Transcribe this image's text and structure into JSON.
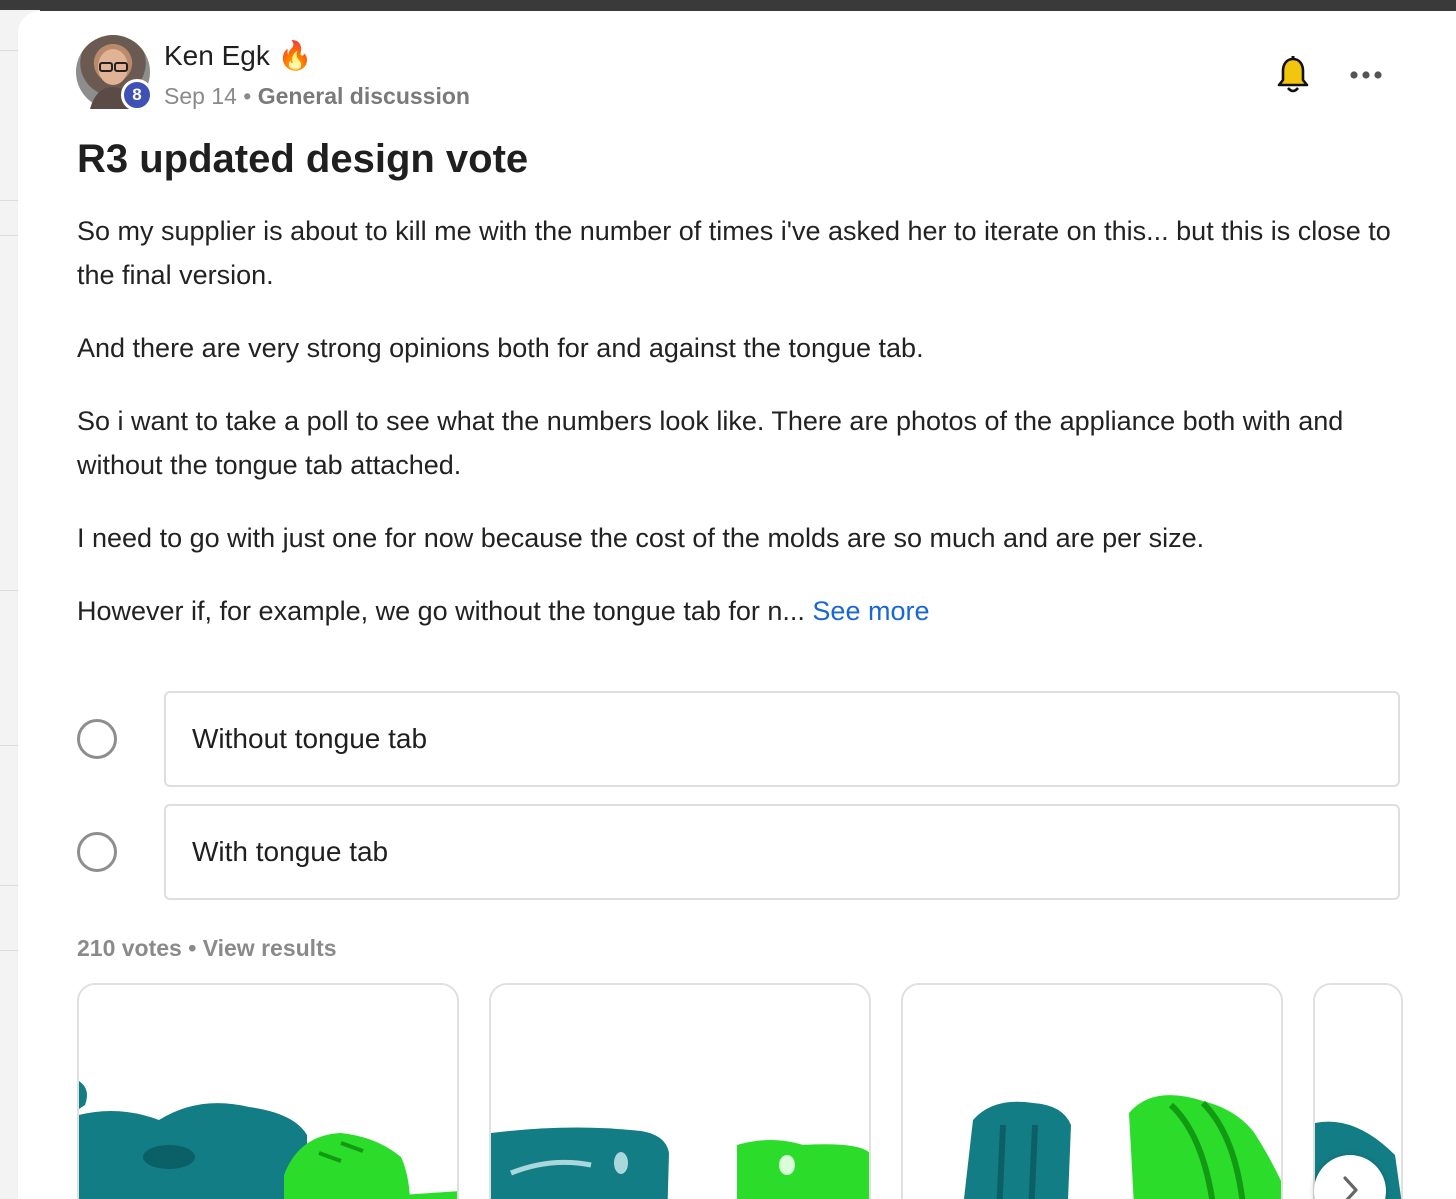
{
  "post": {
    "author": "Ken Egk",
    "author_emoji": "🔥",
    "level": "8",
    "date": "Sep 14",
    "separator": "•",
    "category": "General discussion",
    "title": "R3 updated design vote",
    "paragraphs": [
      "So my supplier is about to kill me with the number of times i've asked her to iterate on this... but this is close to the final version.",
      "And there are very strong opinions both for and against the tongue tab.",
      "So i want to take a poll to see what the numbers look like. There are photos of the appliance both with and without the tongue tab attached.",
      "I need to go with just one for now because the cost of the molds are so much and are per size.",
      "However if, for example, we go without the tongue tab for n..."
    ],
    "see_more": "See more"
  },
  "poll": {
    "options": [
      "Without tongue tab",
      "With tongue tab"
    ],
    "votes_text": "210 votes",
    "separator": "•",
    "view_results": "View results"
  },
  "icons": {
    "bell": "bell-icon",
    "more": "more-horizontal-icon",
    "next": "chevron-right-icon"
  },
  "colors": {
    "link": "#1a66d4",
    "badge": "#3f51b5",
    "teal": "#137d86",
    "green": "#22dd22"
  }
}
